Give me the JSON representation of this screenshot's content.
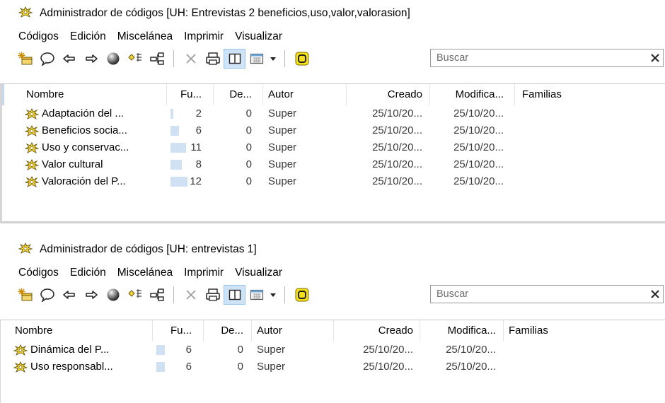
{
  "window1": {
    "title": "Administrador de códigos [UH: Entrevistas 2 beneficios,uso,valor,valorasion]",
    "menu": [
      "Códigos",
      "Edición",
      "Miscelánea",
      "Imprimir",
      "Visualizar"
    ],
    "search_placeholder": "Buscar",
    "columns": [
      "Nombre",
      "Fu...",
      "De...",
      "Autor",
      "Creado",
      "Modifica...",
      "Familias"
    ],
    "rows": [
      {
        "name": "Adaptación del ...",
        "fu": "2",
        "de": "0",
        "autor": "Super",
        "creado": "25/10/20...",
        "modificado": "25/10/20...",
        "familias": "",
        "fu_level": 0.167
      },
      {
        "name": "Beneficios socia...",
        "fu": "6",
        "de": "0",
        "autor": "Super",
        "creado": "25/10/20...",
        "modificado": "25/10/20...",
        "familias": "",
        "fu_level": 0.5
      },
      {
        "name": "Uso y conservac...",
        "fu": "11",
        "de": "0",
        "autor": "Super",
        "creado": "25/10/20...",
        "modificado": "25/10/20...",
        "familias": "",
        "fu_level": 0.917
      },
      {
        "name": "Valor cultural",
        "fu": "8",
        "de": "0",
        "autor": "Super",
        "creado": "25/10/20...",
        "modificado": "25/10/20...",
        "familias": "",
        "fu_level": 0.667
      },
      {
        "name": "Valoración del P...",
        "fu": "12",
        "de": "0",
        "autor": "Super",
        "creado": "25/10/20...",
        "modificado": "25/10/20...",
        "familias": "",
        "fu_level": 1.0
      }
    ]
  },
  "window2": {
    "title": "Administrador de códigos [UH: entrevistas 1]",
    "menu": [
      "Códigos",
      "Edición",
      "Miscelánea",
      "Imprimir",
      "Visualizar"
    ],
    "search_placeholder": "Buscar",
    "columns": [
      "Nombre",
      "Fu...",
      "De...",
      "Autor",
      "Creado",
      "Modifica...",
      "Familias"
    ],
    "rows": [
      {
        "name": "Dinámica del P...",
        "fu": "6",
        "de": "0",
        "autor": "Super",
        "creado": "25/10/20...",
        "modificado": "25/10/20...",
        "familias": "",
        "fu_level": 0.5
      },
      {
        "name": "Uso responsabl...",
        "fu": "6",
        "de": "0",
        "autor": "Super",
        "creado": "25/10/20...",
        "modificado": "25/10/20...",
        "familias": "",
        "fu_level": 0.5
      }
    ]
  },
  "colors": {
    "accent": "#99c4ec",
    "bar": "#cfe1f3",
    "code_icon": "#f2d43a"
  },
  "icons": {
    "title": "code-manager-icon",
    "toolbar": [
      "new-code-icon",
      "comment-icon",
      "back-arrow-icon",
      "forward-arrow-icon",
      "sphere-icon",
      "filter-icon",
      "network-icon",
      "delete-icon",
      "print-icon",
      "split-view-icon",
      "table-view-icon",
      "dropdown-icon",
      "highlight-icon"
    ],
    "close": "close-icon",
    "row": "code-icon"
  }
}
